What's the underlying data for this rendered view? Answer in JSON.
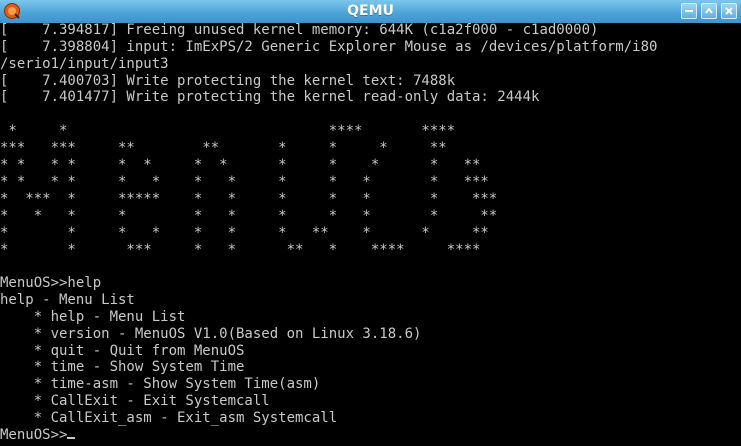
{
  "window": {
    "title": "QEMU",
    "icon": "qemu-app-icon",
    "buttons": [
      "minimize",
      "maximize",
      "close"
    ]
  },
  "colors": {
    "titlebar": "#4ea4d8",
    "console_bg": "#000000",
    "console_text": "#c8c8c8"
  },
  "console": {
    "kernel_lines": [
      "[    7.394817] Freeing unused kernel memory: 644K (c1a2f000 - c1ad0000)",
      "[    7.398804] input: ImExPS/2 Generic Explorer Mouse as /devices/platform/i80",
      "/serio1/input/input3",
      "[    7.400703] Write protecting the kernel text: 7488k",
      "[    7.401477] Write protecting the kernel read-only data: 2444k"
    ],
    "banner_art": [
      " *     *                               ****       ****",
      "***   ***     **        **       *     *     *     **",
      "* *   * *     *  *     *  *      *     *    *      *   **",
      "* *   * *     *   *    *   *     *     *   *       *   ***",
      "*  ***  *     *****    *   *     *     *   *       *    ***",
      "*   *   *     *        *   *     *     *   *       *     **",
      "*       *     *   *    *   *     *   **    *      *     **",
      "*       *      ***     *   *      **   *    ****     ****"
    ],
    "session": {
      "prompt_cmd": "MenuOS>>help",
      "header": "help - Menu List",
      "menu_items": [
        "    * help - Menu List",
        "    * version - MenuOS V1.0(Based on Linux 3.18.6)",
        "    * quit - Quit from MenuOS",
        "    * time - Show System Time",
        "    * time-asm - Show System Time(asm)",
        "    * CallExit - Exit Systemcall",
        "    * CallExit_asm - Exit_asm Systemcall"
      ],
      "final_prompt": "MenuOS>>"
    }
  }
}
